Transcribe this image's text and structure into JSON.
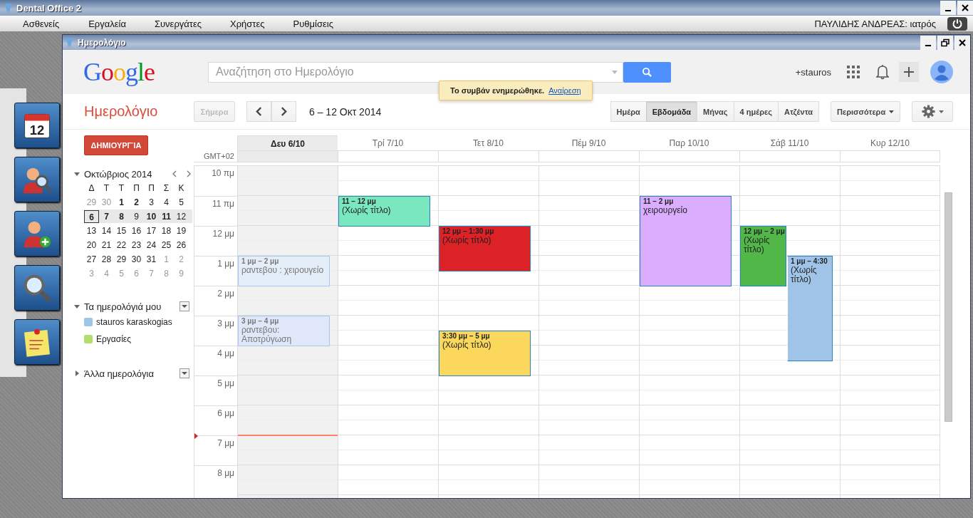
{
  "app": {
    "title": "Dental Office 2"
  },
  "menu": [
    {
      "label": "Ασθενείς"
    },
    {
      "label": "Εργαλεία"
    },
    {
      "label": "Συνεργάτες"
    },
    {
      "label": "Χρήστες"
    },
    {
      "label": "Ρυθμίσεις"
    }
  ],
  "user": "ΠΑΥΛΙΔΗΣ ΑΝΔΡΕΑΣ: ιατρός",
  "dock": [
    {
      "kind": "calendar",
      "text": "12"
    },
    {
      "kind": "patient-search"
    },
    {
      "kind": "add-patient"
    },
    {
      "kind": "search"
    },
    {
      "kind": "note"
    }
  ],
  "window": {
    "title": "Ημερολόγιο"
  },
  "header": {
    "logo": "Google",
    "search": {
      "placeholder": "Αναζήτηση στο Ημερολόγιο"
    },
    "account": "+stauros"
  },
  "toast": {
    "message": "Το συμβάν ενημερώθηκε.",
    "link": "Αναίρεση"
  },
  "toolbar": {
    "title": "Ημερολόγιο",
    "today": {
      "label": "Σήμερα",
      "disabled": true
    },
    "range": "6 – 12 Οκτ 2014",
    "views": [
      {
        "label": "Ημέρα",
        "selected": false
      },
      {
        "label": "Εβδομάδα",
        "selected": true
      },
      {
        "label": "Μήνας",
        "selected": false
      },
      {
        "label": "4 ημέρες",
        "selected": false
      },
      {
        "label": "Ατζέντα",
        "selected": false
      }
    ],
    "more": "Περισσότερα"
  },
  "sidebar": {
    "create": "ΔΗΜΙΟΥΡΓΊΑ",
    "month": {
      "label": "Οκτώβριος 2014",
      "expanded": true
    },
    "weekdays": [
      "Δ",
      "Τ",
      "Τ",
      "Π",
      "Π",
      "Σ",
      "Κ"
    ],
    "weeks": [
      {
        "selected": false,
        "days": [
          {
            "label": "29",
            "muted": true,
            "bold": false,
            "selected": false
          },
          {
            "label": "30",
            "muted": true,
            "bold": false,
            "selected": false
          },
          {
            "label": "1",
            "muted": false,
            "bold": true,
            "selected": false
          },
          {
            "label": "2",
            "muted": false,
            "bold": true,
            "selected": false
          },
          {
            "label": "3",
            "muted": false,
            "bold": false,
            "selected": false
          },
          {
            "label": "4",
            "muted": false,
            "bold": false,
            "selected": false
          },
          {
            "label": "5",
            "muted": false,
            "bold": false,
            "selected": false
          }
        ]
      },
      {
        "selected": true,
        "days": [
          {
            "label": "6",
            "muted": false,
            "bold": true,
            "selected": true
          },
          {
            "label": "7",
            "muted": false,
            "bold": true,
            "selected": false
          },
          {
            "label": "8",
            "muted": false,
            "bold": true,
            "selected": false
          },
          {
            "label": "9",
            "muted": false,
            "bold": false,
            "selected": false
          },
          {
            "label": "10",
            "muted": false,
            "bold": true,
            "selected": false
          },
          {
            "label": "11",
            "muted": false,
            "bold": true,
            "selected": false
          },
          {
            "label": "12",
            "muted": false,
            "bold": false,
            "selected": false
          }
        ]
      },
      {
        "selected": false,
        "days": [
          {
            "label": "13",
            "muted": false,
            "bold": false,
            "selected": false
          },
          {
            "label": "14",
            "muted": false,
            "bold": false,
            "selected": false
          },
          {
            "label": "15",
            "muted": false,
            "bold": false,
            "selected": false
          },
          {
            "label": "16",
            "muted": false,
            "bold": false,
            "selected": false
          },
          {
            "label": "17",
            "muted": false,
            "bold": false,
            "selected": false
          },
          {
            "label": "18",
            "muted": false,
            "bold": false,
            "selected": false
          },
          {
            "label": "19",
            "muted": false,
            "bold": false,
            "selected": false
          }
        ]
      },
      {
        "selected": false,
        "days": [
          {
            "label": "20",
            "muted": false,
            "bold": false,
            "selected": false
          },
          {
            "label": "21",
            "muted": false,
            "bold": false,
            "selected": false
          },
          {
            "label": "22",
            "muted": false,
            "bold": false,
            "selected": false
          },
          {
            "label": "23",
            "muted": false,
            "bold": false,
            "selected": false
          },
          {
            "label": "24",
            "muted": false,
            "bold": false,
            "selected": false
          },
          {
            "label": "25",
            "muted": false,
            "bold": false,
            "selected": false
          },
          {
            "label": "26",
            "muted": false,
            "bold": false,
            "selected": false
          }
        ]
      },
      {
        "selected": false,
        "days": [
          {
            "label": "27",
            "muted": false,
            "bold": false,
            "selected": false
          },
          {
            "label": "28",
            "muted": false,
            "bold": false,
            "selected": false
          },
          {
            "label": "29",
            "muted": false,
            "bold": false,
            "selected": false
          },
          {
            "label": "30",
            "muted": false,
            "bold": false,
            "selected": false
          },
          {
            "label": "31",
            "muted": false,
            "bold": false,
            "selected": false
          },
          {
            "label": "1",
            "muted": true,
            "bold": false,
            "selected": false
          },
          {
            "label": "2",
            "muted": true,
            "bold": false,
            "selected": false
          }
        ]
      },
      {
        "selected": false,
        "days": [
          {
            "label": "3",
            "muted": true,
            "bold": false,
            "selected": false
          },
          {
            "label": "4",
            "muted": true,
            "bold": false,
            "selected": false
          },
          {
            "label": "5",
            "muted": true,
            "bold": false,
            "selected": false
          },
          {
            "label": "6",
            "muted": true,
            "bold": false,
            "selected": false
          },
          {
            "label": "7",
            "muted": true,
            "bold": false,
            "selected": false
          },
          {
            "label": "8",
            "muted": true,
            "bold": false,
            "selected": false
          },
          {
            "label": "9",
            "muted": true,
            "bold": false,
            "selected": false
          }
        ]
      }
    ],
    "my_calendars": {
      "title": "Τα ημερολόγιά μου",
      "expanded": true,
      "items": [
        {
          "name": "stauros karaskogias",
          "color": "#9fc6e7"
        },
        {
          "name": "Εργασίες",
          "color": "#b3dc6c"
        }
      ]
    },
    "other_calendars": {
      "title": "Άλλα ημερολόγια",
      "expanded": false
    }
  },
  "grid": {
    "timezone": "GMT+02",
    "hours": [
      {
        "label": "10 πμ",
        "now": false
      },
      {
        "label": "11 πμ",
        "now": false
      },
      {
        "label": "12 μμ",
        "now": false
      },
      {
        "label": "1 μμ",
        "now": false
      },
      {
        "label": "2 μμ",
        "now": false
      },
      {
        "label": "3 μμ",
        "now": false
      },
      {
        "label": "4 μμ",
        "now": false
      },
      {
        "label": "5 μμ",
        "now": false
      },
      {
        "label": "6 μμ",
        "now": false
      },
      {
        "label": "7 μμ",
        "now": true
      },
      {
        "label": "8 μμ",
        "now": false
      }
    ],
    "days": [
      {
        "label": "Δευ 6/10",
        "today": true,
        "events": [
          {
            "time": "1 μμ – 2 μμ",
            "title": "ραντεβου : χειρουγείο",
            "color": "#e4eef8",
            "faded": true
          },
          {
            "time": "3 μμ – 4 μμ",
            "title": "ραντεβου: Αποτρύγωση",
            "color": "#dfe7f9",
            "faded": true
          }
        ]
      },
      {
        "label": "Τρί 7/10",
        "today": false,
        "events": [
          {
            "time": "11 – 12 μμ",
            "title": "(Χωρίς τίτλο)",
            "color": "#7ae7bf",
            "faded": false
          }
        ]
      },
      {
        "label": "Τετ 8/10",
        "today": false,
        "events": [
          {
            "time": "12 μμ – 1:30 μμ",
            "title": "(Χωρίς τίτλο)",
            "color": "#dc2127",
            "faded": false
          },
          {
            "time": "3:30 μμ – 5 μμ",
            "title": "(Χωρίς τίτλο)",
            "color": "#fbd75b",
            "faded": false
          }
        ]
      },
      {
        "label": "Πέμ 9/10",
        "today": false
      },
      {
        "label": "Παρ 10/10",
        "today": false,
        "events": [
          {
            "time": "11 – 2 μμ",
            "title": "χειρουργείο",
            "color": "#dbadff",
            "faded": false
          }
        ]
      },
      {
        "label": "Σάβ 11/10",
        "today": false,
        "events": [
          {
            "time": "12 μμ – 2 μμ",
            "title": "(Χωρίς τίτλο)",
            "color": "#51b749",
            "faded": false
          },
          {
            "time": "1 μμ – 4:30",
            "title": "(Χωρίς τίτλο)",
            "color": "#a0c4e8",
            "faded": false
          }
        ]
      },
      {
        "label": "Κυρ 12/10",
        "today": false
      }
    ]
  }
}
